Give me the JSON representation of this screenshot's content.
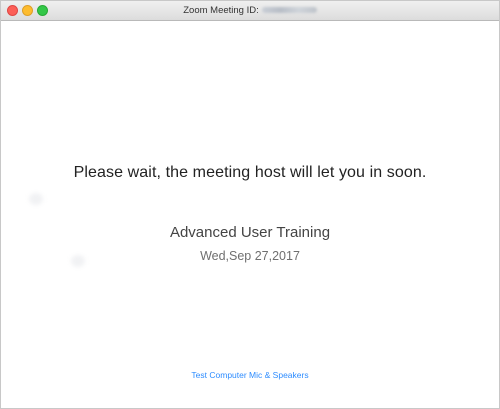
{
  "window": {
    "title_prefix": "Zoom Meeting ID:"
  },
  "main": {
    "wait_message": "Please wait, the meeting host will let you in soon.",
    "meeting_topic": "Advanced User Training",
    "meeting_date": "Wed,Sep 27,2017",
    "test_audio_link": "Test Computer Mic & Speakers"
  },
  "colors": {
    "link": "#2d8cff",
    "close": "#fc5f57",
    "minimize": "#fdbc2e",
    "zoom": "#33c748"
  }
}
